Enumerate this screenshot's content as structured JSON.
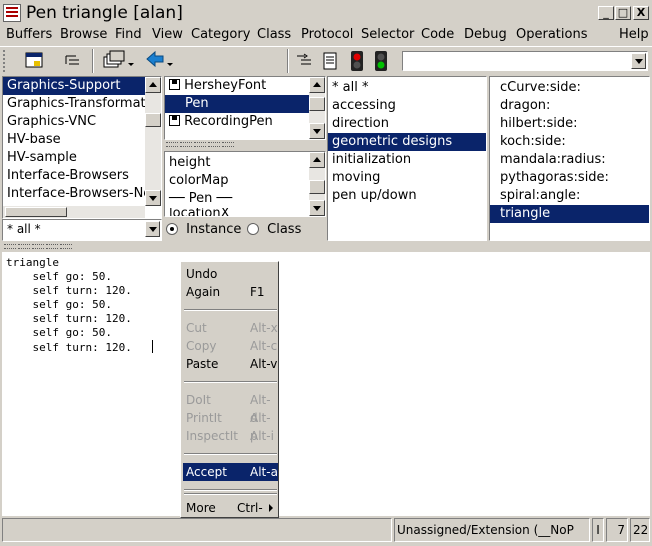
{
  "window": {
    "title": "Pen triangle [alan]",
    "minimize": "_",
    "maximize": "□",
    "close": "X"
  },
  "menubar": [
    "Buffers",
    "Browse",
    "Find",
    "View",
    "Category",
    "Class",
    "Protocol",
    "Selector",
    "Code",
    "Debug",
    "Operations",
    "Help"
  ],
  "packages": {
    "items": [
      "Graphics-Support",
      "Graphics-Transformati",
      "Graphics-VNC",
      "HV-base",
      "HV-sample",
      "Interface-Browsers",
      "Interface-Browsers-Ne"
    ],
    "selected": "Graphics-Support",
    "filter": "* all *"
  },
  "classes": {
    "items": [
      "HersheyFont",
      "Pen",
      "RecordingPen"
    ],
    "selected": "Pen"
  },
  "variables": {
    "items": [
      "height",
      "colorMap",
      "── Pen ──",
      "locationX"
    ]
  },
  "instance_class": {
    "instance_label": "Instance",
    "class_label": "Class",
    "selected": "instance"
  },
  "protocols": {
    "items": [
      "* all *",
      "accessing",
      "direction",
      "geometric designs",
      "initialization",
      "moving",
      "pen up/down"
    ],
    "selected": "geometric designs"
  },
  "selectors": {
    "items": [
      "cCurve:side:",
      "dragon:",
      "hilbert:side:",
      "koch:side:",
      "mandala:radius:",
      "pythagoras:side:",
      "spiral:angle:",
      "triangle"
    ],
    "selected": "triangle"
  },
  "code": {
    "lines": [
      "triangle",
      "    self go: 50.",
      "    self turn: 120.",
      "    self go: 50.",
      "    self turn: 120.",
      "    self go: 50.",
      "    self turn: 120."
    ]
  },
  "context_menu": {
    "undo": "Undo",
    "again": "Again",
    "again_key": "F1",
    "cut": "Cut",
    "cut_key": "Alt-x",
    "copy": "Copy",
    "copy_key": "Alt-c",
    "paste": "Paste",
    "paste_key": "Alt-v",
    "doit": "DoIt",
    "doit_key": "Alt-d",
    "printit": "PrintIt",
    "printit_key": "Alt-p",
    "inspectit": "InspectIt",
    "inspectit_key": "Alt-i",
    "accept": "Accept",
    "accept_key": "Alt-a",
    "more": "More",
    "more_key": "Ctrl-"
  },
  "status": {
    "message": "",
    "mode": "Unassigned/Extension (__NoP",
    "indicator": "I",
    "line": "7",
    "col": "22"
  },
  "colors": {
    "selection": "#0a246a",
    "face": "#d4d0c8"
  }
}
